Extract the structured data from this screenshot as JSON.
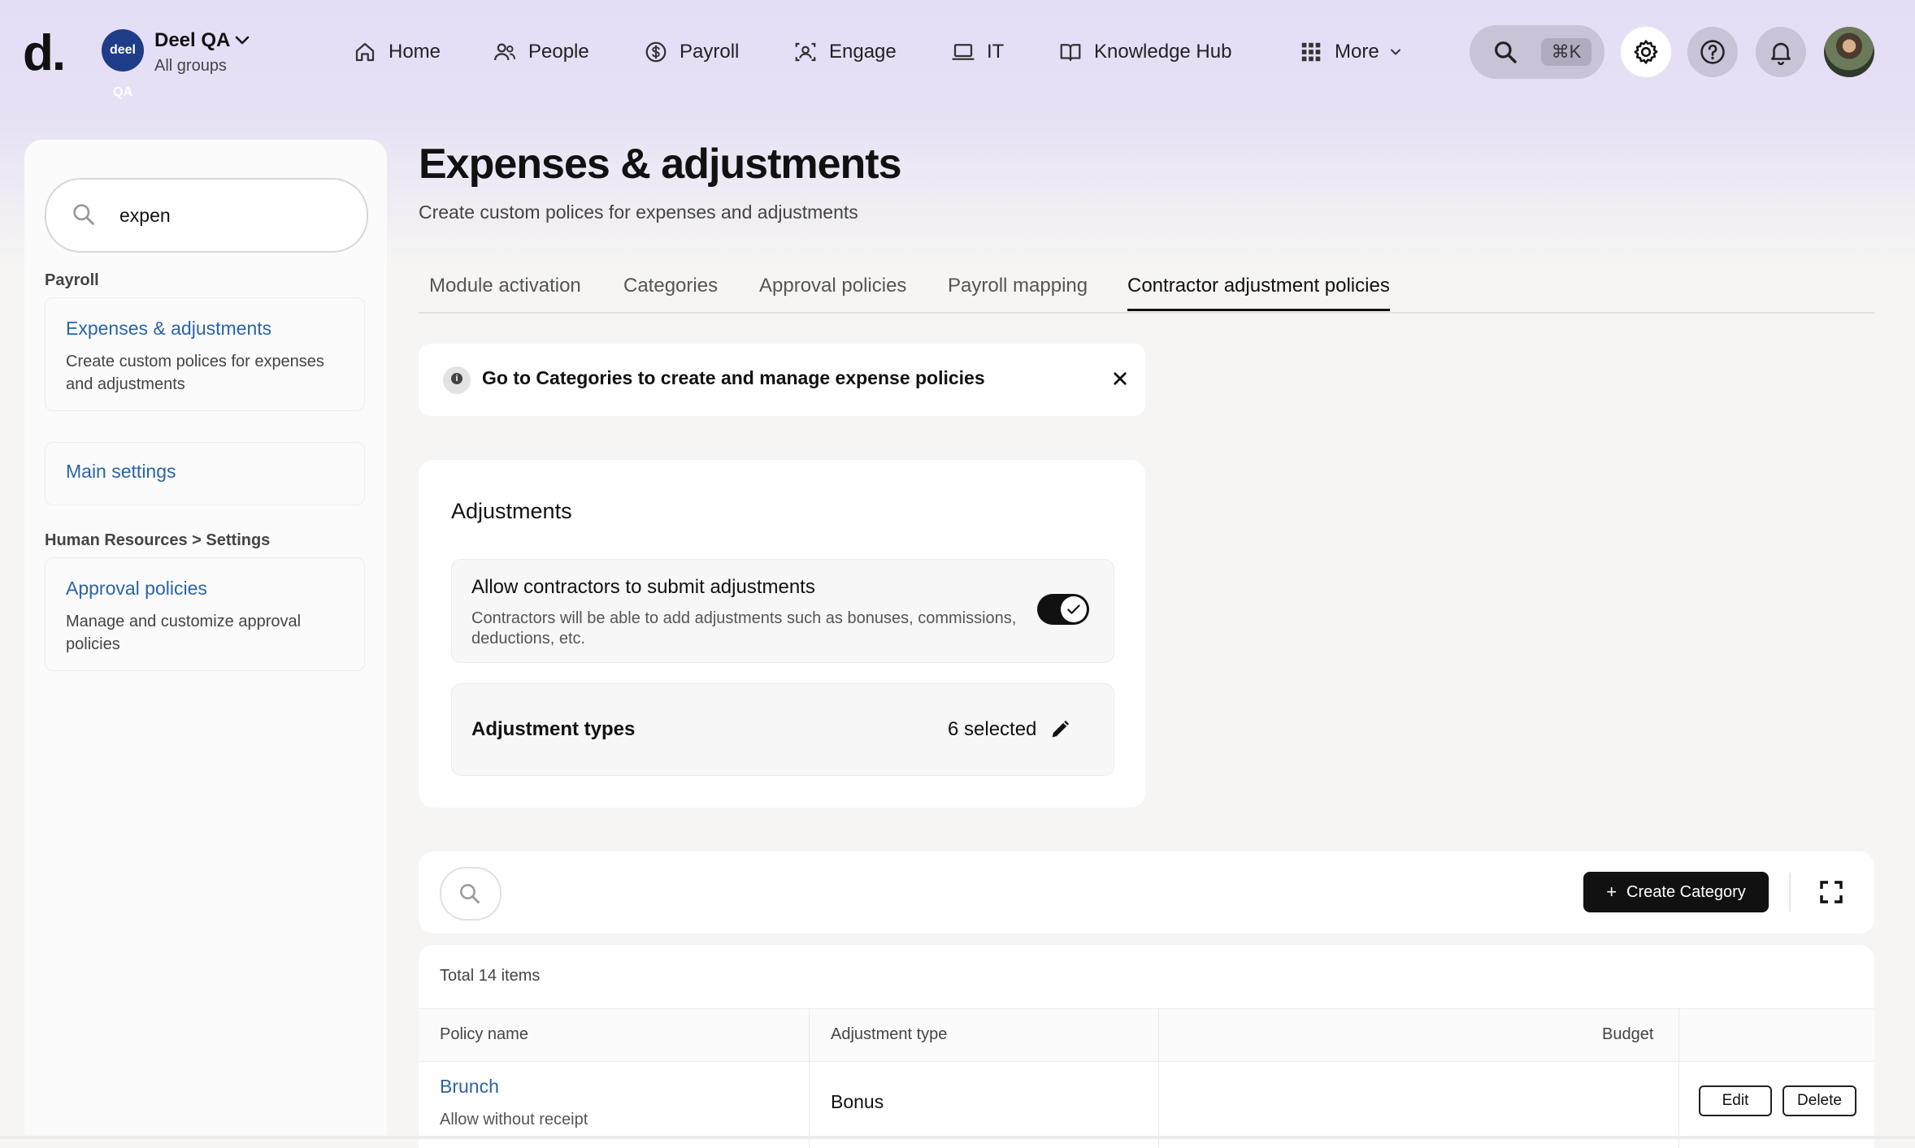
{
  "topbar": {
    "logo": "d.",
    "org": {
      "avatar_text": "deel QA",
      "name": "Deel QA",
      "subtitle": "All groups"
    },
    "nav": [
      {
        "label": "Home",
        "icon": "home-icon"
      },
      {
        "label": "People",
        "icon": "people-icon"
      },
      {
        "label": "Payroll",
        "icon": "payroll-icon"
      },
      {
        "label": "Engage",
        "icon": "engage-icon"
      },
      {
        "label": "IT",
        "icon": "laptop-icon"
      },
      {
        "label": "Knowledge Hub",
        "icon": "book-icon"
      },
      {
        "label": "More",
        "icon": "grid-icon"
      }
    ],
    "search_shortcut": "⌘K",
    "icons": [
      "search-icon",
      "gear-icon",
      "help-icon",
      "bell-icon",
      "user-avatar"
    ]
  },
  "sidebar": {
    "search": {
      "value": "expen",
      "icon": "search-icon"
    },
    "sections": [
      {
        "label": "Payroll",
        "results": [
          {
            "title": "Expenses & adjustments",
            "description": "Create custom polices for expenses and adjustments"
          },
          {
            "title": "Main settings",
            "description": ""
          }
        ]
      },
      {
        "label": "Human Resources > Settings",
        "results": [
          {
            "title": "Approval policies",
            "description": "Manage and customize approval policies"
          }
        ]
      }
    ]
  },
  "main": {
    "title": "Expenses & adjustments",
    "subtitle": "Create custom polices for expenses and adjustments",
    "tabs": [
      {
        "label": "Module activation",
        "active": false
      },
      {
        "label": "Categories",
        "active": false
      },
      {
        "label": "Approval policies",
        "active": false
      },
      {
        "label": "Payroll mapping",
        "active": false
      },
      {
        "label": "Contractor adjustment policies",
        "active": true
      }
    ],
    "alert": {
      "text": "Go to Categories to create and manage expense policies",
      "icon": "info-icon"
    },
    "adjustments": {
      "title": "Adjustments",
      "allow": {
        "title": "Allow contractors to submit adjustments",
        "description": "Contractors will be able to add adjustments such as bonuses, commissions, deductions, etc.",
        "enabled": true
      },
      "types": {
        "label": "Adjustment types",
        "selected": "6 selected"
      }
    },
    "toolbar": {
      "create_label": "Create Category",
      "create_icon": "plus-icon",
      "expand_icon": "expand-icon"
    },
    "table": {
      "total": "Total 14 items",
      "columns": [
        "Policy name",
        "Adjustment type",
        "Budget"
      ],
      "rows": [
        {
          "name": "Brunch",
          "subtext": "Allow without receipt",
          "type": "Bonus",
          "budget": "",
          "edit": "Edit",
          "delete": "Delete"
        }
      ]
    }
  },
  "colors": {
    "accent_link": "#2a64a8",
    "header_bg": "#e4ddf7",
    "primary_button": "#111111"
  }
}
